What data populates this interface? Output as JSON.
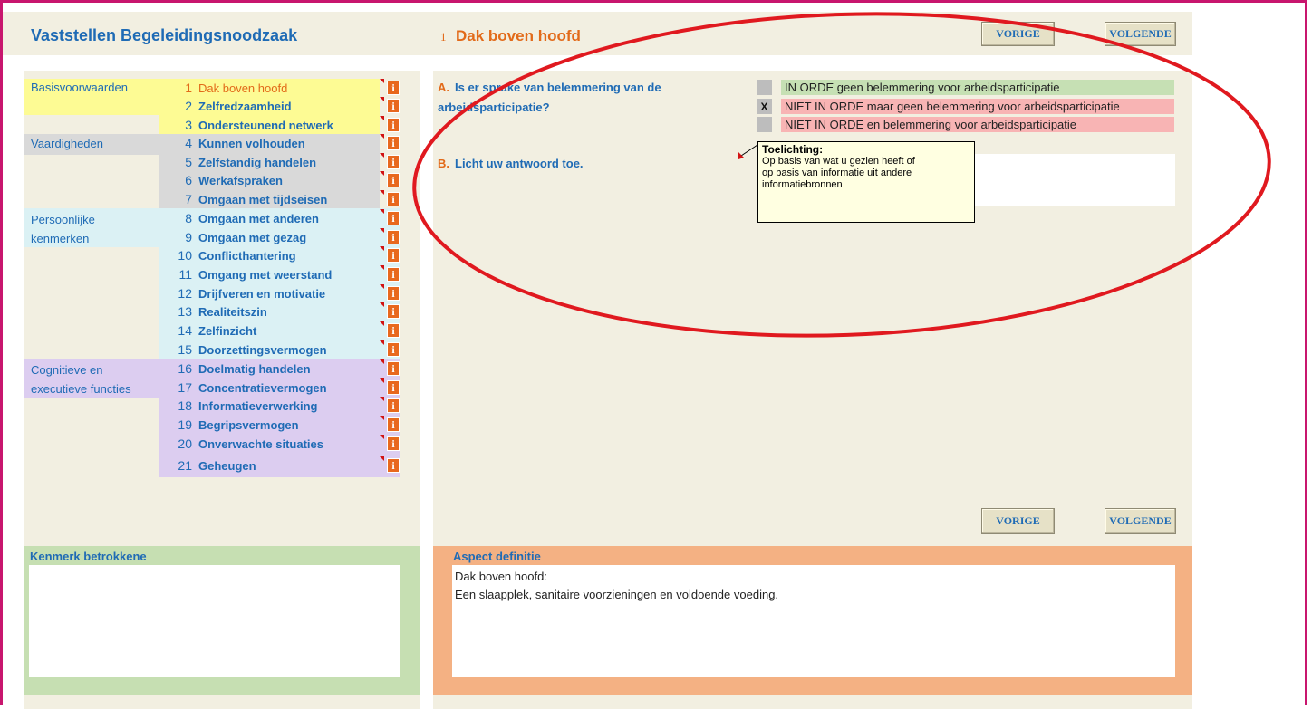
{
  "header": {
    "title": "Vaststellen Begeleidingsnoodzaak",
    "section_number": "1",
    "section_title": "Dak boven hoofd",
    "prev_label": "VORIGE",
    "next_label": "VOLGENDE"
  },
  "categories": [
    {
      "label": "Basisvoorwaarden",
      "color": "#fdfb94"
    },
    {
      "label": "Vaardigheden",
      "color": "#d9d9d9"
    },
    {
      "label": "Persoonlijke kenmerken",
      "color": "#dbf1f4"
    },
    {
      "label": "Cognitieve en executieve functies",
      "color": "#dccdf0"
    }
  ],
  "nav_items": [
    {
      "num": "1",
      "label": "Dak boven hoofd"
    },
    {
      "num": "2",
      "label": "Zelfredzaamheid"
    },
    {
      "num": "3",
      "label": "Ondersteunend netwerk"
    },
    {
      "num": "4",
      "label": "Kunnen volhouden"
    },
    {
      "num": "5",
      "label": "Zelfstandig handelen"
    },
    {
      "num": "6",
      "label": "Werkafspraken"
    },
    {
      "num": "7",
      "label": "Omgaan met tijdseisen"
    },
    {
      "num": "8",
      "label": "Omgaan met anderen"
    },
    {
      "num": "9",
      "label": "Omgaan met gezag"
    },
    {
      "num": "10",
      "label": "Conflicthantering"
    },
    {
      "num": "11",
      "label": "Omgang met weerstand"
    },
    {
      "num": "12",
      "label": "Drijfveren en motivatie"
    },
    {
      "num": "13",
      "label": "Realiteitszin"
    },
    {
      "num": "14",
      "label": "Zelfinzicht"
    },
    {
      "num": "15",
      "label": "Doorzettingsvermogen"
    },
    {
      "num": "16",
      "label": "Doelmatig handelen"
    },
    {
      "num": "17",
      "label": "Concentratievermogen"
    },
    {
      "num": "18",
      "label": "Informatieverwerking"
    },
    {
      "num": "19",
      "label": "Begripsvermogen"
    },
    {
      "num": "20",
      "label": "Onverwachte situaties"
    },
    {
      "num": "21",
      "label": "Geheugen"
    }
  ],
  "info_glyph": "i",
  "question_a": {
    "letter": "A.",
    "text_line1": "Is er sprake van belemmering van de",
    "text_line2": "arbeidsparticipatie?"
  },
  "options": [
    {
      "mark": "",
      "label": "IN ORDE geen belemmering voor arbeidsparticipatie",
      "color": "#c6e0b4"
    },
    {
      "mark": "X",
      "label": "NIET IN ORDE maar geen belemmering voor arbeidsparticipatie",
      "color": "#f8b4b4"
    },
    {
      "mark": "",
      "label": "NIET IN ORDE en belemmering voor arbeidsparticipatie",
      "color": "#f8b4b4"
    }
  ],
  "question_b": {
    "letter": "B.",
    "text": "Licht uw antwoord toe."
  },
  "tooltip": {
    "title": "Toelichting:",
    "body": "Op basis van wat u gezien heeft of op basis van informatie uit andere informatiebronnen"
  },
  "panels": {
    "kenmerk_label": "Kenmerk betrokkene",
    "kenmerk_value": "",
    "aspect_label": "Aspect definitie",
    "aspect_line1": "Dak boven hoofd:",
    "aspect_line2": "Een slaapplek, sanitaire voorzieningen en voldoende voeding."
  },
  "colors": {
    "accent_blue": "#1f6bb5",
    "accent_orange": "#e26a19",
    "frame_magenta": "#c8166e",
    "annotation_red": "#e0191f",
    "panel_green": "#c6dfb2",
    "panel_orange": "#f4b183"
  }
}
